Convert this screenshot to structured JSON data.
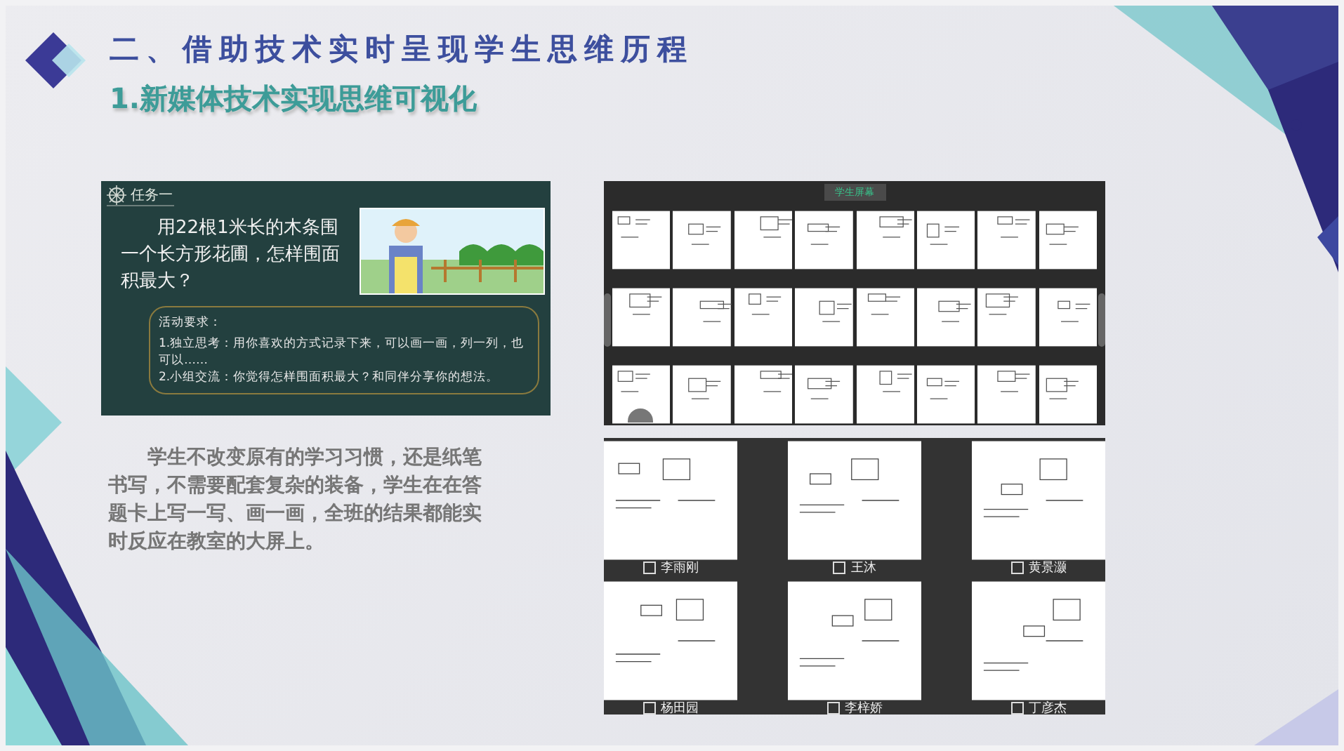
{
  "slide": {
    "title": "二、借助技术实时呈现学生思维历程",
    "subtitle": "1.新媒体技术实现思维可视化"
  },
  "task_card": {
    "label": "任务一",
    "question": "用22根1米长的木条围一个长方形花圃，怎样围面积最大？",
    "requirements_title": "活动要求：",
    "requirements": [
      "1.独立思考：用你喜欢的方式记录下来，可以画一画，列一列，也可以……",
      "2.小组交流：你觉得怎样围面积最大？和同伴分享你的想法。"
    ]
  },
  "description": "学生不改变原有的学习习惯，还是纸笔书写，不需要配套复杂的装备，学生在在答题卡上写一写、画一画，全班的结果都能实时反应在教室的大屏上。",
  "screen_grid": {
    "button": "学生屏幕"
  },
  "student_works": [
    {
      "name": "李雨刚",
      "checked": false
    },
    {
      "name": "王沐",
      "checked": false
    },
    {
      "name": "黄景灏",
      "checked": false
    },
    {
      "name": "杨田园",
      "checked": false
    },
    {
      "name": "李梓娇",
      "checked": false
    },
    {
      "name": "丁彦杰",
      "checked": false
    }
  ]
}
